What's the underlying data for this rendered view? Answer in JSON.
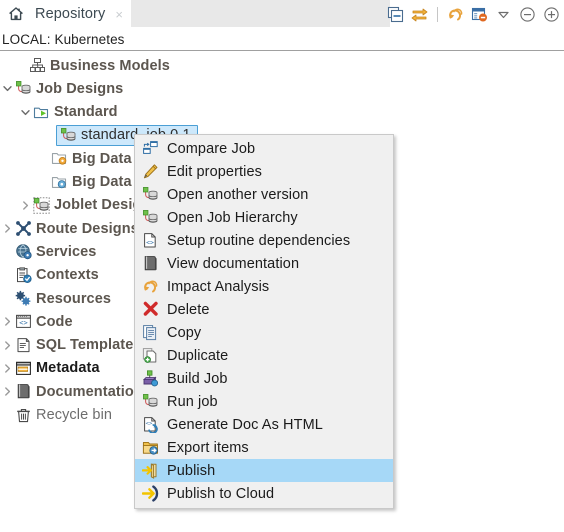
{
  "view": {
    "tab": {
      "title": "Repository",
      "icon": "home-icon",
      "close_label": "×"
    },
    "toolbar": [
      {
        "name": "collapse-all-icon",
        "tooltip": "Collapse All"
      },
      {
        "name": "link-with-editor-icon",
        "tooltip": "Link with Editor"
      },
      {
        "name": "refresh-icon",
        "tooltip": "Refresh"
      },
      {
        "name": "filter-icon",
        "tooltip": "Filter"
      },
      {
        "name": "view-menu-icon",
        "tooltip": "View Menu"
      },
      {
        "name": "minimize-icon",
        "tooltip": "Minimize"
      },
      {
        "name": "maximize-icon",
        "tooltip": "Maximize"
      }
    ],
    "connection_label": "LOCAL: Kubernetes"
  },
  "tree": {
    "items": [
      {
        "label": "Business Models",
        "icon": "business-models-icon",
        "indent": 28,
        "arrow": "none",
        "style": "bold"
      },
      {
        "label": "Job Designs",
        "icon": "job-designs-icon",
        "indent": 14,
        "arrow": "down",
        "style": "bold"
      },
      {
        "label": "Standard",
        "icon": "standard-folder-icon",
        "indent": 32,
        "arrow": "down",
        "style": "bold"
      },
      {
        "label": "standard_job 0.1",
        "icon": "job-item-icon",
        "indent": 56,
        "arrow": "none",
        "style": "selected"
      },
      {
        "label": "Big Data Batch",
        "icon": "big-data-batch-icon",
        "indent": 50,
        "arrow": "none",
        "style": "bold"
      },
      {
        "label": "Big Data Streaming",
        "icon": "big-data-streaming-icon",
        "indent": 50,
        "arrow": "none",
        "style": "bold"
      },
      {
        "label": "Joblet Designs",
        "icon": "joblet-designs-icon",
        "indent": 32,
        "arrow": "right",
        "style": "bold"
      },
      {
        "label": "Route Designs",
        "icon": "route-designs-icon",
        "indent": 14,
        "arrow": "right",
        "style": "bold"
      },
      {
        "label": "Services",
        "icon": "services-icon",
        "indent": 14,
        "arrow": "none",
        "style": "bold"
      },
      {
        "label": "Contexts",
        "icon": "contexts-icon",
        "indent": 14,
        "arrow": "none",
        "style": "bold"
      },
      {
        "label": "Resources",
        "icon": "resources-icon",
        "indent": 14,
        "arrow": "none",
        "style": "bold"
      },
      {
        "label": "Code",
        "icon": "code-icon",
        "indent": 14,
        "arrow": "right",
        "style": "bold"
      },
      {
        "label": "SQL Templates",
        "icon": "sql-templates-icon",
        "indent": 14,
        "arrow": "right",
        "style": "bold"
      },
      {
        "label": "Metadata",
        "icon": "metadata-icon",
        "indent": 14,
        "arrow": "right",
        "style": "bold-dark"
      },
      {
        "label": "Documentation",
        "icon": "documentation-icon",
        "indent": 14,
        "arrow": "right",
        "style": "bold"
      },
      {
        "label": "Recycle bin",
        "icon": "recycle-bin-icon",
        "indent": 14,
        "arrow": "none",
        "style": "plain"
      }
    ]
  },
  "context_menu": {
    "items": [
      {
        "label": "Compare Job",
        "icon": "compare-job-icon",
        "highlighted": false
      },
      {
        "label": "Edit properties",
        "icon": "pencil-icon",
        "highlighted": false
      },
      {
        "label": "Open another version",
        "icon": "job-item-icon",
        "highlighted": false
      },
      {
        "label": "Open Job Hierarchy",
        "icon": "job-item-icon",
        "highlighted": false
      },
      {
        "label": "Setup routine dependencies",
        "icon": "routine-dependencies-icon",
        "highlighted": false
      },
      {
        "label": "View documentation",
        "icon": "documentation-icon",
        "highlighted": false
      },
      {
        "label": "Impact Analysis",
        "icon": "impact-analysis-icon",
        "highlighted": false
      },
      {
        "label": "Delete",
        "icon": "delete-x-icon",
        "highlighted": false
      },
      {
        "label": "Copy",
        "icon": "copy-icon",
        "highlighted": false
      },
      {
        "label": "Duplicate",
        "icon": "duplicate-icon",
        "highlighted": false
      },
      {
        "label": "Build Job",
        "icon": "build-job-icon",
        "highlighted": false
      },
      {
        "label": "Run job",
        "icon": "job-item-icon",
        "highlighted": false
      },
      {
        "label": "Generate Doc As HTML",
        "icon": "generate-doc-icon",
        "highlighted": false
      },
      {
        "label": "Export items",
        "icon": "export-items-icon",
        "highlighted": false
      },
      {
        "label": "Publish",
        "icon": "publish-icon",
        "highlighted": true
      },
      {
        "label": "Publish to Cloud",
        "icon": "publish-to-cloud-icon",
        "highlighted": false
      }
    ]
  },
  "colors": {
    "selection_fill": "#cde8fb",
    "selection_border": "#4b9fd5",
    "menu_highlight": "#a6d8f7",
    "menu_bg": "#f0f0f0",
    "tree_label": "#5c564f",
    "accent_orange": "#e8a33d"
  }
}
